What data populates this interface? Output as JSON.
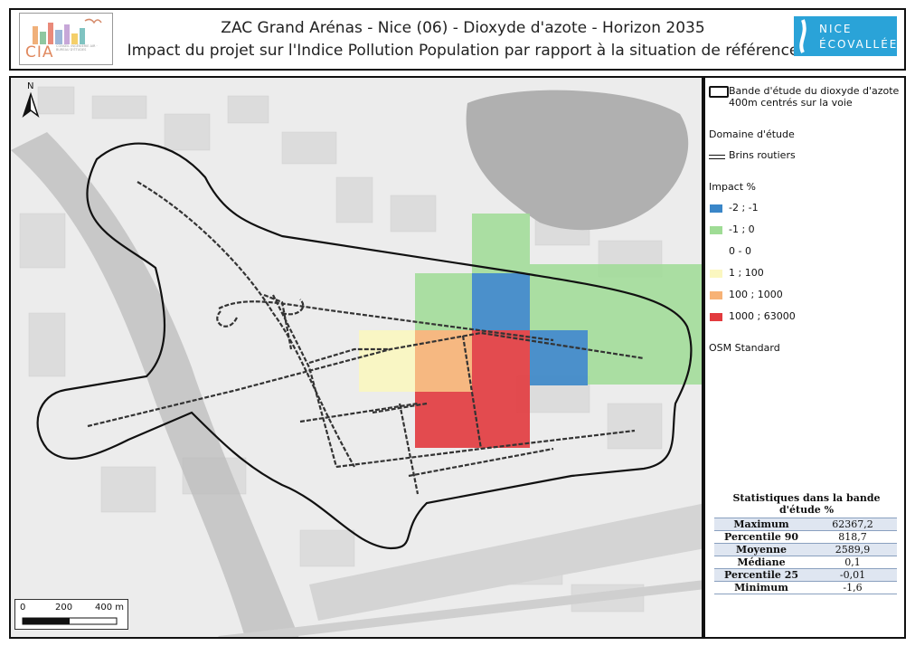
{
  "header": {
    "title_line1": "ZAC Grand Arénas - Nice (06) - Dioxyde d'azote - Horizon 2035",
    "title_line2": "Impact du projet sur l'Indice Pollution Population par rapport à la situation de référence",
    "logo_left": {
      "acronym": "CIA",
      "text": "CONSEIL INGÉNIERIE AIR · BUREAU D'ÉTUDES"
    },
    "logo_right": {
      "line1": "NICE",
      "line2": "ÉCOVALLÉE",
      "color": "#2aa3d8"
    }
  },
  "map": {
    "north_arrow_letter": "N",
    "scale_labels": [
      "0",
      "200",
      "400 m"
    ],
    "colors": {
      "study_band_outline": "#111111",
      "roads": "#333333",
      "impact_blue": "#3a86c8",
      "impact_green": "#9fdc95",
      "impact_yellow": "#fbf7c0",
      "impact_orange": "#f7b276",
      "impact_red": "#e23a3e"
    }
  },
  "legend": {
    "band_label_line1": "Bande d'étude du dioxyde d'azote",
    "band_label_line2": "400m centrés sur la voie",
    "domain_label": "Domaine d'étude",
    "roads_label": "Brins routiers",
    "impact_title": "Impact %",
    "classes": [
      {
        "label": "-2 ; -1",
        "color": "#3a86c8"
      },
      {
        "label": "-1 ; 0",
        "color": "#9fdc95"
      },
      {
        "label": "0 - 0",
        "color": "#ffffff"
      },
      {
        "label": "1 ; 100",
        "color": "#fbf7c0"
      },
      {
        "label": "100 ; 1000",
        "color": "#f7b276"
      },
      {
        "label": "1000 ; 63000",
        "color": "#e23a3e"
      }
    ],
    "basemap_label": "OSM Standard"
  },
  "stats": {
    "title": "Statistiques dans la bande d'étude %",
    "rows": [
      {
        "label": "Maximum",
        "value": "62367,2"
      },
      {
        "label": "Percentile 90",
        "value": "818,7"
      },
      {
        "label": "Moyenne",
        "value": "2589,9"
      },
      {
        "label": "Médiane",
        "value": "0,1"
      },
      {
        "label": "Percentile 25",
        "value": "-0,01"
      },
      {
        "label": "Minimum",
        "value": "-1,6"
      }
    ]
  }
}
